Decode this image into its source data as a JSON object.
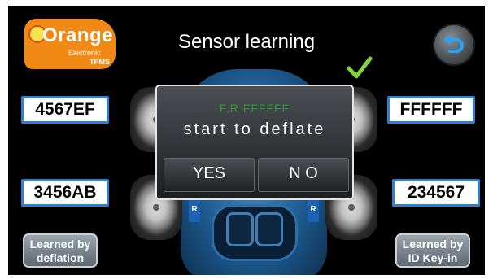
{
  "header": {
    "title": "Sensor learning",
    "logo": {
      "main": "Orange",
      "line1": "Electronic",
      "line2": "TPMS"
    },
    "back_icon": "undo-arrow-icon",
    "status_icon": "green-checkmark-icon"
  },
  "sensors": {
    "front_left": "4567EF",
    "front_right": "FFFFFF",
    "rear_left": "3456AB",
    "rear_right": "234567"
  },
  "wheel_tags": {
    "left": "R",
    "right": "R"
  },
  "modes": {
    "deflation": {
      "line1": "Learned by",
      "line2": "deflation"
    },
    "keyin": {
      "line1": "Learned by",
      "line2": "ID Key-in"
    }
  },
  "dialog": {
    "sensor_line": "F.R FFFFFF",
    "message": "start to deflate",
    "yes_label": "YES",
    "no_label": "N O"
  },
  "colors": {
    "background": "#000000",
    "id_box_border": "#2f7fd2",
    "dialog_id_text": "#2f9a34",
    "logo_orange": "#f08a14"
  }
}
